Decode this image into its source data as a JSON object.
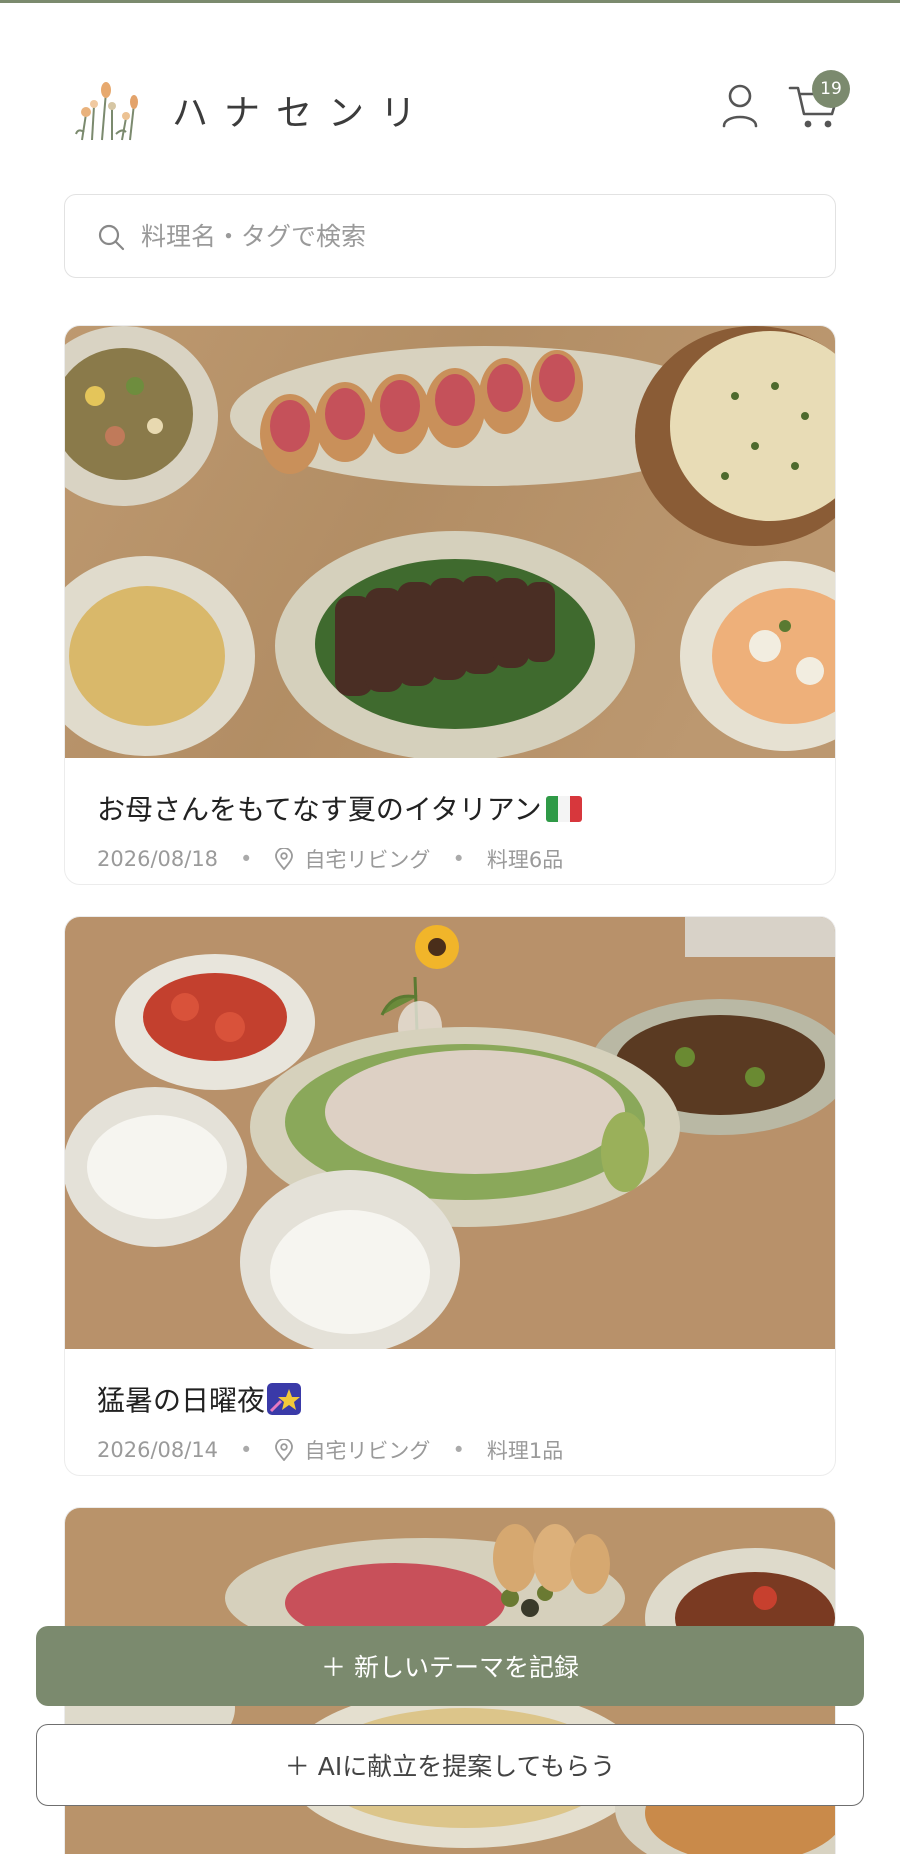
{
  "app": {
    "brand_name": "ハナセンリ",
    "cart_count": "19",
    "accent_color": "#7b8a6e"
  },
  "search": {
    "placeholder": "料理名・タグで検索"
  },
  "cards": [
    {
      "title": "お母さんをもてなす夏のイタリアン",
      "title_emoji": "italian-flag",
      "date": "2026/08/18",
      "location": "自宅リビング",
      "dish_count": "料理6品"
    },
    {
      "title": "猛暑の日曜夜",
      "title_emoji": "shooting-star",
      "date": "2026/08/14",
      "location": "自宅リビング",
      "dish_count": "料理1品"
    },
    {
      "title": "",
      "title_emoji": "",
      "date": "",
      "location": "",
      "dish_count": ""
    }
  ],
  "actions": {
    "new_theme": "＋ 新しいテーマを記録",
    "ai_suggest": "＋ AIに献立を提案してもらう"
  }
}
